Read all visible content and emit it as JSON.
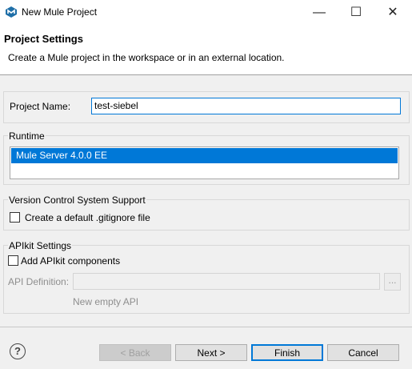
{
  "window": {
    "title": "New Mule Project",
    "minimize": "—",
    "maximize": "☐",
    "close": "✕",
    "icon": "mule-app-icon"
  },
  "header": {
    "title": "Project Settings",
    "description": "Create a Mule project in the workspace or in an external location."
  },
  "project_name": {
    "label": "Project Name:",
    "value": "test-siebel"
  },
  "runtime": {
    "title": "Runtime",
    "items": [
      "Mule Server 4.0.0 EE"
    ]
  },
  "vcs": {
    "title": "Version Control System Support",
    "gitignore_label": "Create a default .gitignore file",
    "gitignore_checked": false
  },
  "apikit": {
    "title": "APIkit Settings",
    "add_label": "Add APIkit components",
    "add_checked": false,
    "api_definition_label": "API Definition:",
    "api_definition_value": "",
    "browse_label": "...",
    "note": "New empty API"
  },
  "footer": {
    "help": "?",
    "back": "< Back",
    "next": "Next >",
    "finish": "Finish",
    "cancel": "Cancel"
  },
  "colors": {
    "selection": "#0078d7",
    "background": "#f0f0f0"
  }
}
